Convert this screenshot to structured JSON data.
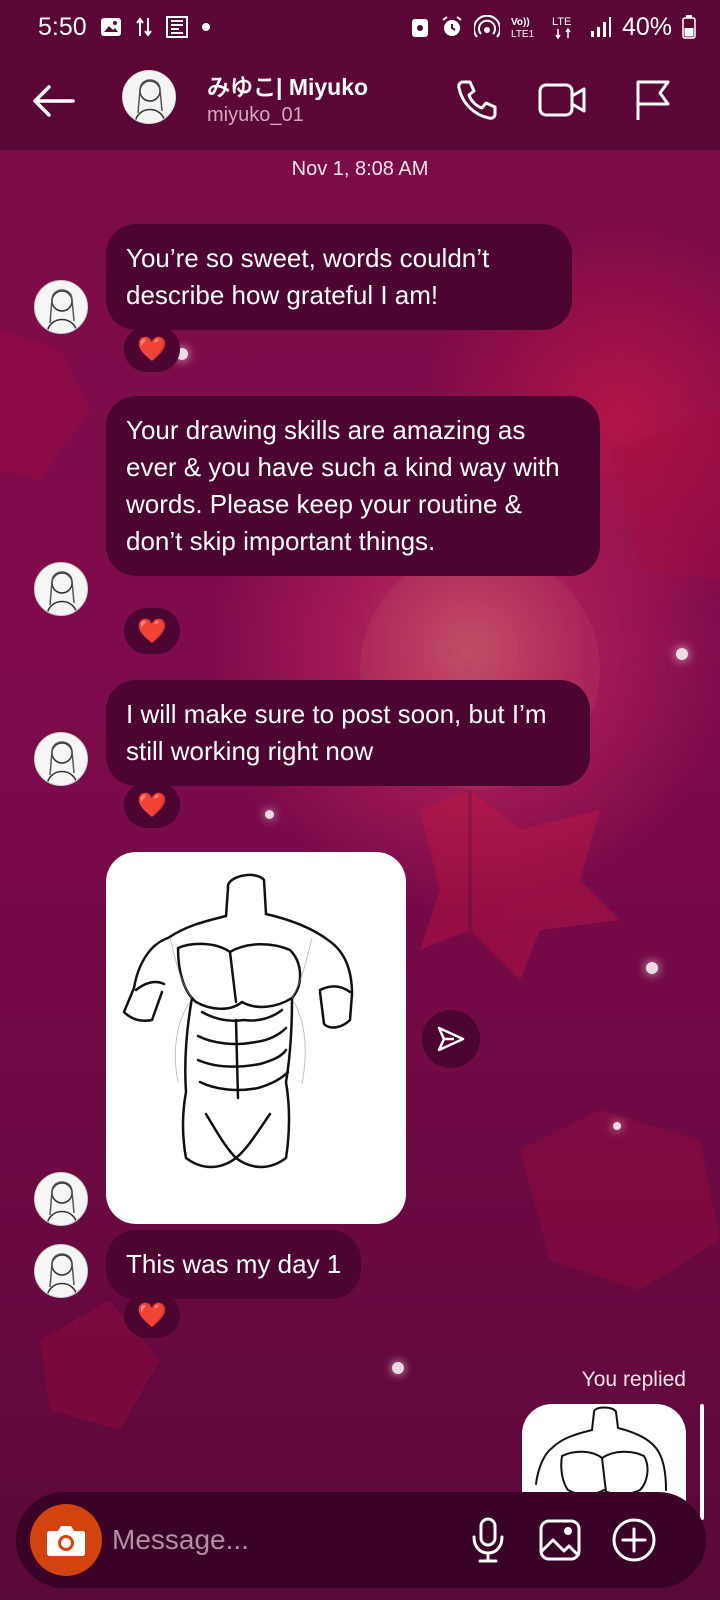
{
  "status_bar": {
    "time": "5:50",
    "battery": "40%",
    "network": "LTE"
  },
  "header": {
    "name": "みゆこ| Miyuko",
    "username": "miyuko_01"
  },
  "conversation": {
    "date": "Nov 1, 8:08 AM",
    "messages": [
      {
        "text": "You’re so sweet, words couldn’t describe how grateful I am!",
        "reaction": "❤️"
      },
      {
        "text": "Your drawing skills are amazing as ever & you have such a kind way with words. Please keep your routine & don’t skip important things.",
        "reaction": "❤️"
      },
      {
        "text": "I will make sure to post soon, but I’m still working right now",
        "reaction": "❤️"
      },
      {
        "text": "This was my day 1",
        "reaction": "❤️"
      }
    ],
    "you_replied": "You replied"
  },
  "composer": {
    "placeholder": "Message..."
  },
  "colors": {
    "header_bg": "#5a0736",
    "bubble_bg": "#4c0431",
    "camera_button": "#d2430f",
    "heart": "#ff2a47"
  }
}
